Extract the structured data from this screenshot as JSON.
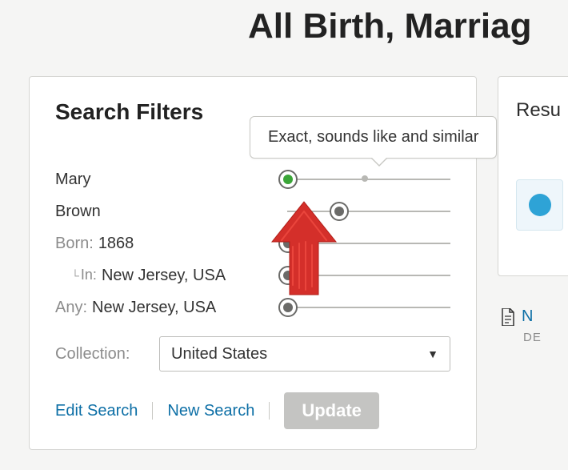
{
  "page": {
    "title_visible": "All Birth, Marriag"
  },
  "tooltip": {
    "text": "Exact, sounds like and similar"
  },
  "filters": {
    "heading": "Search Filters",
    "first_name": "Mary",
    "last_name": "Brown",
    "born_label": "Born:",
    "born_year": "1868",
    "in_label": "In:",
    "in_place": "New Jersey, USA",
    "any_label": "Any:",
    "any_place": "New Jersey, USA",
    "collection_label": "Collection:",
    "collection_value": "United States",
    "sliders": {
      "first_name": {
        "pos_pct": 5,
        "style": "green",
        "show_mid": true
      },
      "last_name": {
        "pos_pct": 35,
        "style": "gray",
        "show_mid": false
      },
      "born_year": {
        "pos_pct": 5,
        "style": "gray",
        "show_mid": false
      },
      "in_place": {
        "pos_pct": 5,
        "style": "gray",
        "show_mid": false
      },
      "any_place": {
        "pos_pct": 5,
        "style": "gray",
        "show_mid": false
      }
    }
  },
  "actions": {
    "edit_search": "Edit Search",
    "new_search": "New Search",
    "update": "Update"
  },
  "results": {
    "heading_visible": "Resu",
    "link_visible": "N",
    "subtext_visible": "DE"
  },
  "annotations": {
    "red_arrow": true
  }
}
